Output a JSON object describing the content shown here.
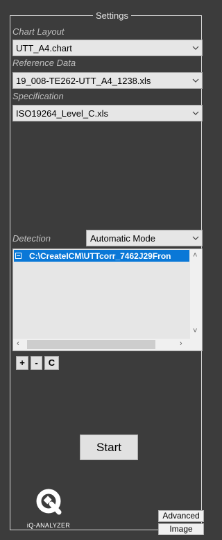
{
  "settings": {
    "title": "Settings",
    "chart_layout": {
      "label": "Chart Layout",
      "value": "UTT_A4.chart"
    },
    "reference_data": {
      "label": "Reference Data",
      "value": "19_008-TE262-UTT_A4_1238.xls"
    },
    "specification": {
      "label": "Specification",
      "value": "ISO19264_Level_C.xls"
    }
  },
  "detection": {
    "label": "Detection",
    "mode": "Automatic Mode",
    "files": [
      {
        "path": "C:\\CreateICM\\UTTcorr_7462J29Fron",
        "selected": true
      }
    ],
    "buttons": {
      "add": "+",
      "remove": "-",
      "clear": "C"
    }
  },
  "actions": {
    "start": "Start"
  },
  "logo": {
    "text": "iQ-ANALYZER"
  },
  "side_buttons": {
    "advanced": "Advanced",
    "image": "Image"
  },
  "icons": {
    "dropdown": "chevron-down-icon",
    "scroll_up": "triangle-up-icon",
    "scroll_down": "triangle-down-icon",
    "scroll_left": "triangle-left-icon",
    "scroll_right": "triangle-right-icon",
    "logo": "iq-analyzer-logo"
  },
  "colors": {
    "background": "#3c3c3c",
    "selection": "#0a78d7"
  }
}
